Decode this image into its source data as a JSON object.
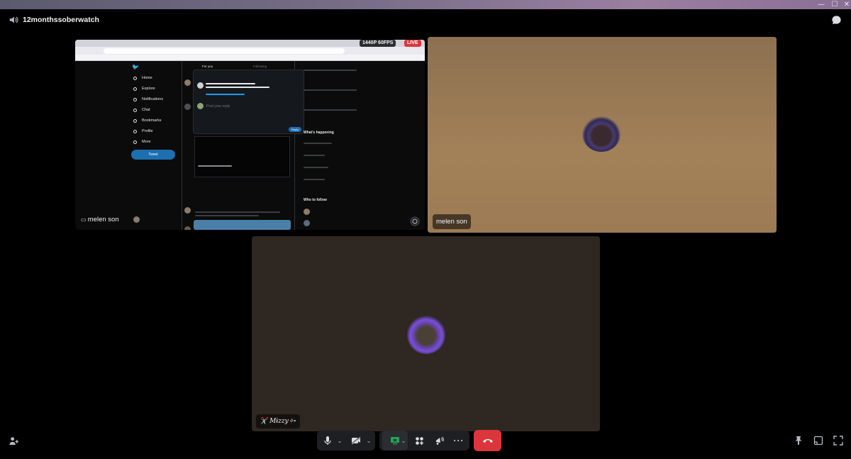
{
  "window": {
    "controls": [
      "—",
      "☐",
      "✕"
    ]
  },
  "header": {
    "channel_name": "12monthssoberwatch",
    "channel_icon": "speaker-icon",
    "chat_icon": "chat-bubble-icon"
  },
  "tiles": {
    "stream": {
      "user": "melen son",
      "quality": "1440P 60FPS",
      "live": "LIVE",
      "twitter_nav": [
        "Home",
        "Explore",
        "Notifications",
        "Chat",
        "Bookmarks",
        "Profile",
        "More"
      ],
      "twitter_tweet_button": "Tweet",
      "reply_placeholder": "Post your reply",
      "reply_button": "Reply",
      "happening_title": "What's happening",
      "follow_title": "Who to follow",
      "feed_tabs": [
        "For you",
        "Following"
      ]
    },
    "camera": {
      "user": "melen son"
    },
    "bottom": {
      "user": "✂️ Mɨzzy✧˖"
    }
  },
  "controlbar": {
    "mic": "microphone-icon",
    "camera_off": "camera-off-icon",
    "screenshare": "screenshare-icon",
    "activities": "activities-icon",
    "soundboard": "soundboard-icon",
    "more": "more-icon",
    "disconnect": "disconnect-icon"
  },
  "colors": {
    "disconnect": "#da373c",
    "screenshare_active": "#23a55a",
    "live": "#da373c",
    "link": "#1d9bf0"
  }
}
